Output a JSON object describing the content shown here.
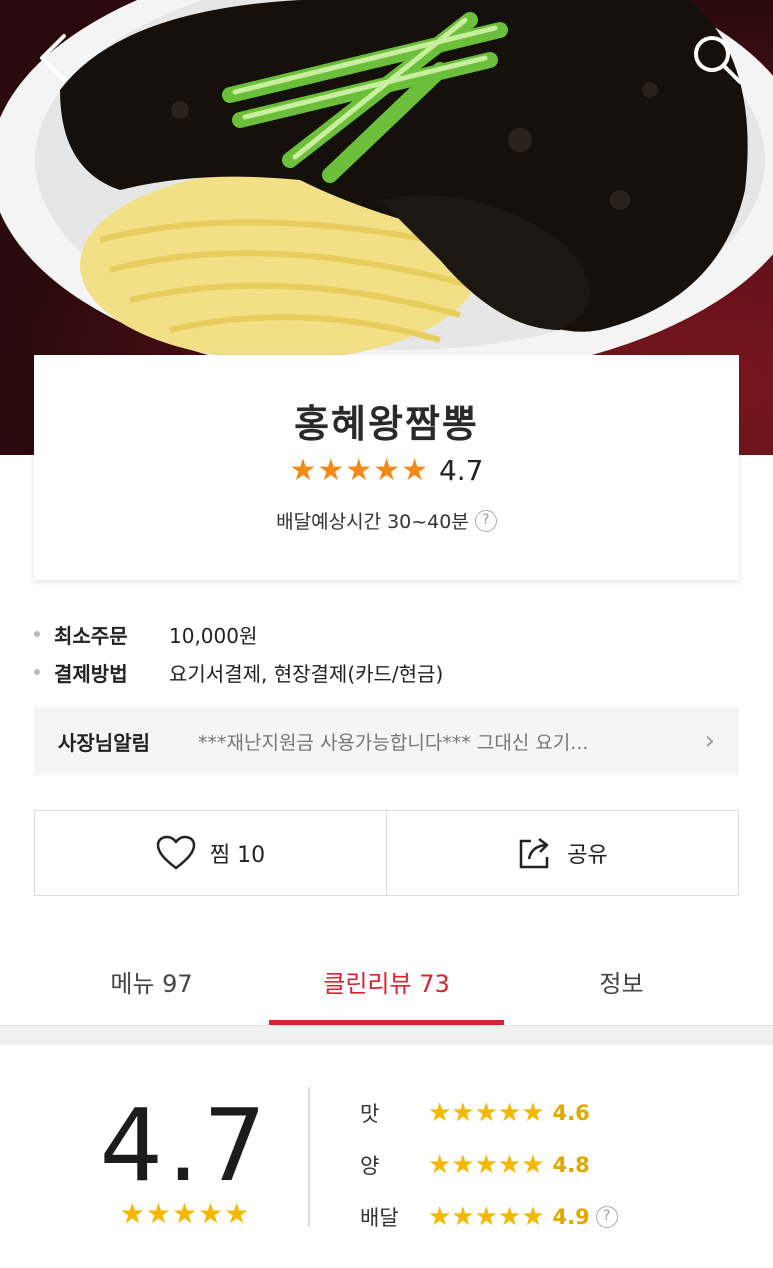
{
  "hero": {
    "back_icon": "chevron-left-icon",
    "search_icon": "search-icon"
  },
  "store": {
    "name": "홍혜왕짬뽕",
    "stars": "★★★★★",
    "rating": "4.7",
    "delivery_label": "배달예상시간",
    "delivery_time": "30~40분",
    "help_icon_text": "?"
  },
  "info": {
    "min_order_label": "최소주문",
    "min_order_value": "10,000원",
    "payment_label": "결제방법",
    "payment_value": "요기서결제, 현장결제(카드/현금)"
  },
  "notice": {
    "label": "사장님알림",
    "text": "***재난지원금 사용가능합니다*** 그대신 요기...",
    "chevron": "›"
  },
  "actions": {
    "like_label": "찜",
    "like_count": "10",
    "share_label": "공유"
  },
  "tabs": [
    {
      "label": "메뉴",
      "count": "97"
    },
    {
      "label": "클린리뷰",
      "count": "73"
    },
    {
      "label": "정보",
      "count": ""
    }
  ],
  "review_summary": {
    "score": "4.7",
    "stars": "★★★★★",
    "taste_label": "맛",
    "taste_stars": "★★★★★",
    "taste_value": "4.6",
    "quantity_label": "양",
    "quantity_stars": "★★★★★",
    "quantity_value": "4.8",
    "delivery_label": "배달",
    "delivery_stars": "★★★★★",
    "delivery_value": "4.9",
    "help_icon_text": "?"
  },
  "colors": {
    "accent": "#d9232e",
    "star_orange": "#f28a1a",
    "star_yellow": "#f5b800"
  }
}
